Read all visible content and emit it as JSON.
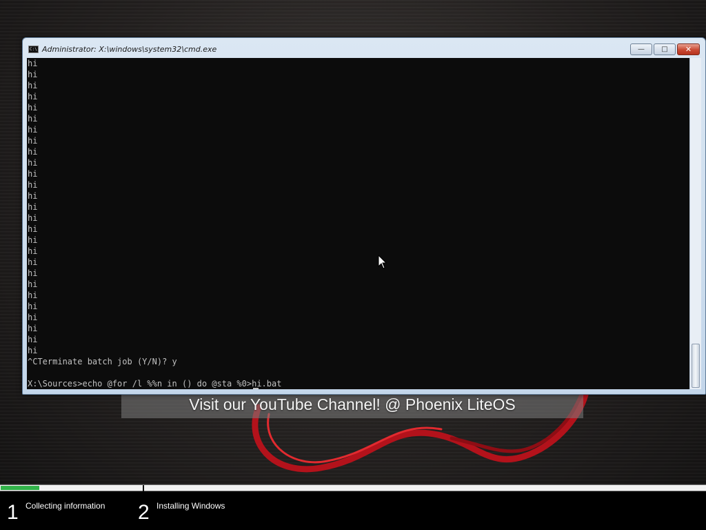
{
  "window": {
    "title": "Administrator: X:\\windows\\system32\\cmd.exe",
    "icon": "cmd-icon",
    "buttons": {
      "minimize": "—",
      "maximize": "□",
      "close": "✕"
    }
  },
  "console": {
    "lines": [
      "hi",
      "hi",
      "hi",
      "hi",
      "hi",
      "hi",
      "hi",
      "hi",
      "hi",
      "hi",
      "hi",
      "hi",
      "hi",
      "hi",
      "hi",
      "hi",
      "hi",
      "hi",
      "hi",
      "hi",
      "hi",
      "hi",
      "hi",
      "hi",
      "hi",
      "hi",
      "hi",
      "^CTerminate batch job (Y/N)? y",
      "",
      "X:\\Sources>echo @for /l %%n in () do @sta %0>hi.bat"
    ],
    "text_color": "#c0c0c0",
    "background": "#0c0c0c"
  },
  "banner": {
    "text": "Visit our YouTube Channel! @ Phoenix LiteOS"
  },
  "setup": {
    "progress": 0.055,
    "progress_color": "#32b24a",
    "steps": [
      {
        "number": "1",
        "label": "Collecting information"
      },
      {
        "number": "2",
        "label": "Installing Windows"
      }
    ]
  }
}
